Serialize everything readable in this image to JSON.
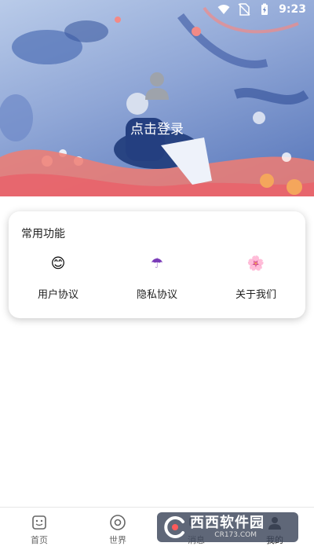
{
  "status_bar": {
    "time": "9:23"
  },
  "header": {
    "login_label": "点击登录"
  },
  "card": {
    "title": "常用功能",
    "items": [
      {
        "icon": "smiley-icon",
        "glyph": "😊",
        "label": "用户协议"
      },
      {
        "icon": "umbrella-icon",
        "glyph": "☂",
        "label": "隐私协议"
      },
      {
        "icon": "flower-icon",
        "glyph": "🌸",
        "label": "关于我们"
      }
    ]
  },
  "tabbar": {
    "tabs": [
      {
        "icon": "home-face-icon",
        "label": "首页"
      },
      {
        "icon": "world-circle-icon",
        "label": "世界"
      },
      {
        "icon": "message-icon",
        "label": "消息"
      },
      {
        "icon": "profile-icon",
        "label": "我的"
      }
    ]
  },
  "watermark": {
    "brand": "西西软件园",
    "site": "CR173.COM"
  }
}
